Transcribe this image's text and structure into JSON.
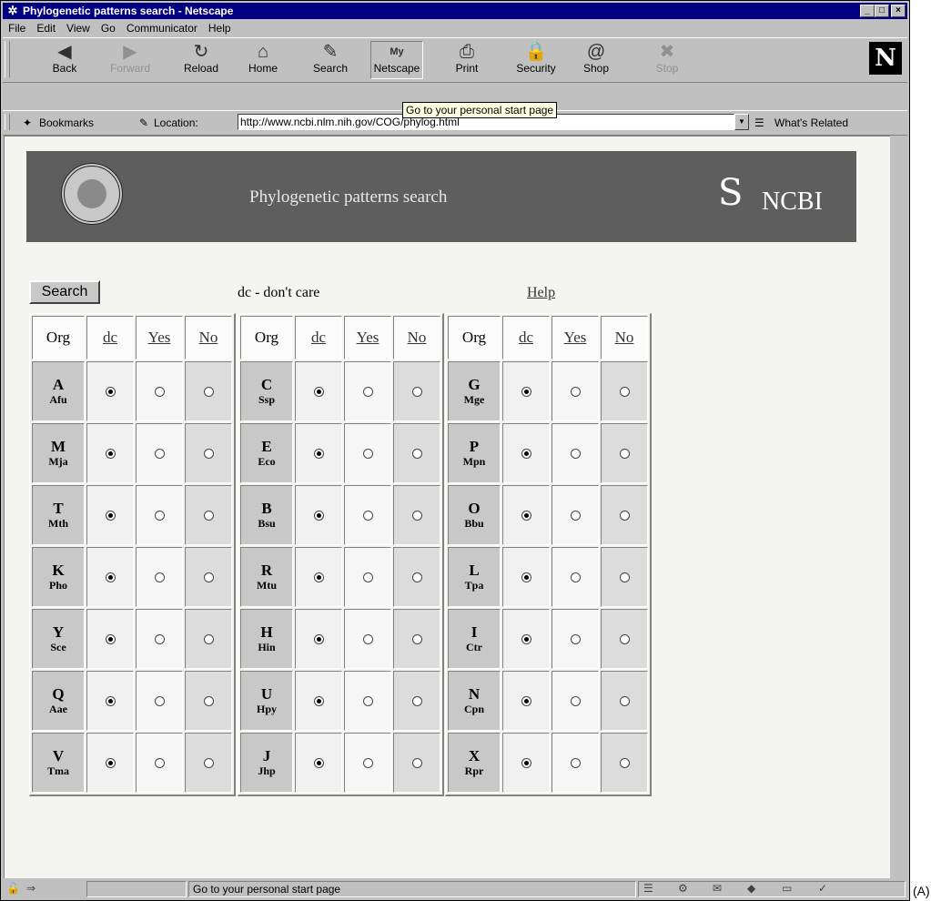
{
  "window": {
    "title": "Phylogenetic patterns search - Netscape",
    "controls": {
      "minimize": "_",
      "maximize": "□",
      "close": "×"
    }
  },
  "menubar": {
    "items": [
      "File",
      "Edit",
      "View",
      "Go",
      "Communicator",
      "Help"
    ]
  },
  "toolbar": {
    "buttons": [
      {
        "label": "Back",
        "icon": "back-arrow-icon",
        "glyph": "◀"
      },
      {
        "label": "Forward",
        "icon": "forward-arrow-icon",
        "glyph": "▶"
      },
      {
        "label": "Reload",
        "icon": "reload-icon",
        "glyph": "↻"
      },
      {
        "label": "Home",
        "icon": "home-icon",
        "glyph": "⌂"
      },
      {
        "label": "Search",
        "icon": "search-icon",
        "glyph": "✎"
      },
      {
        "label": "Netscape",
        "icon": "my-netscape-icon",
        "glyph": "My"
      },
      {
        "label": "Print",
        "icon": "print-icon",
        "glyph": "⎙"
      },
      {
        "label": "Security",
        "icon": "lock-icon",
        "glyph": "🔒"
      },
      {
        "label": "Shop",
        "icon": "shop-icon",
        "glyph": "@"
      },
      {
        "label": "Stop",
        "icon": "stop-icon",
        "glyph": "✖"
      }
    ],
    "brand_letter": "N",
    "tooltip": "Go to your personal start page"
  },
  "location_bar": {
    "bookmarks_label": "Bookmarks",
    "location_label": "Location:",
    "url": "http://www.ncbi.nlm.nih.gov/COG/phylog.html",
    "whats_related_label": "What's Related"
  },
  "banner": {
    "title": "Phylogenetic patterns search",
    "brand": "NCBI",
    "brand_symbol": "S"
  },
  "form": {
    "search_button": "Search",
    "dc_note": "dc - don't care",
    "help_link": "Help",
    "headers": [
      "Org",
      "dc",
      "Yes",
      "No"
    ],
    "tables": [
      [
        {
          "letter": "A",
          "abbr": "Afu",
          "selected": "dc"
        },
        {
          "letter": "M",
          "abbr": "Mja",
          "selected": "dc"
        },
        {
          "letter": "T",
          "abbr": "Mth",
          "selected": "dc"
        },
        {
          "letter": "K",
          "abbr": "Pho",
          "selected": "dc"
        },
        {
          "letter": "Y",
          "abbr": "Sce",
          "selected": "dc"
        },
        {
          "letter": "Q",
          "abbr": "Aae",
          "selected": "dc"
        },
        {
          "letter": "V",
          "abbr": "Tma",
          "selected": "dc"
        }
      ],
      [
        {
          "letter": "C",
          "abbr": "Ssp",
          "selected": "dc"
        },
        {
          "letter": "E",
          "abbr": "Eco",
          "selected": "dc"
        },
        {
          "letter": "B",
          "abbr": "Bsu",
          "selected": "dc"
        },
        {
          "letter": "R",
          "abbr": "Mtu",
          "selected": "dc"
        },
        {
          "letter": "H",
          "abbr": "Hin",
          "selected": "dc"
        },
        {
          "letter": "U",
          "abbr": "Hpy",
          "selected": "dc"
        },
        {
          "letter": "J",
          "abbr": "Jhp",
          "selected": "dc"
        }
      ],
      [
        {
          "letter": "G",
          "abbr": "Mge",
          "selected": "dc"
        },
        {
          "letter": "P",
          "abbr": "Mpn",
          "selected": "dc"
        },
        {
          "letter": "O",
          "abbr": "Bbu",
          "selected": "dc"
        },
        {
          "letter": "L",
          "abbr": "Tpa",
          "selected": "dc"
        },
        {
          "letter": "I",
          "abbr": "Ctr",
          "selected": "dc"
        },
        {
          "letter": "N",
          "abbr": "Cpn",
          "selected": "dc"
        },
        {
          "letter": "X",
          "abbr": "Rpr",
          "selected": "dc"
        }
      ]
    ]
  },
  "statusbar": {
    "text": "Go to your personal start page"
  },
  "figure_label": "(A)"
}
